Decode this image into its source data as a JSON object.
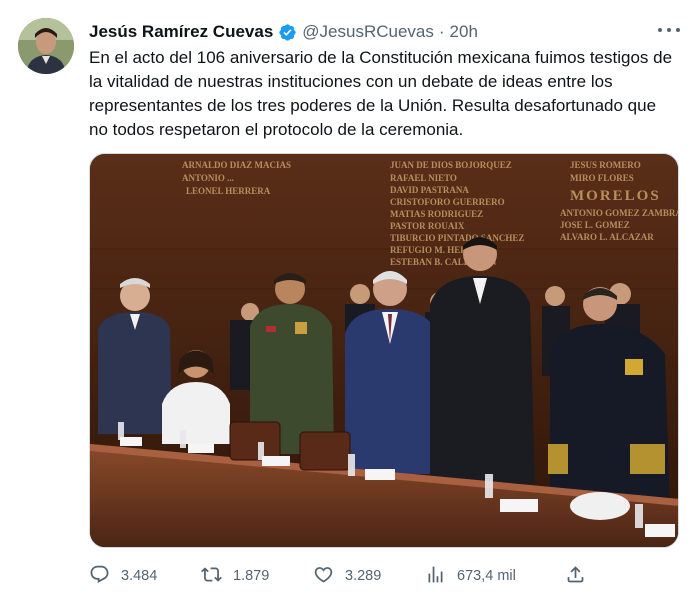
{
  "tweet": {
    "author": {
      "display_name": "Jesús Ramírez Cuevas",
      "handle": "@JesusRCuevas",
      "verified_icon": "verified-badge-icon",
      "avatar_alt": "avatar"
    },
    "separator": "·",
    "time": "20h",
    "more_icon": "more-options-icon",
    "text": "En el acto del 106 aniversario de la Constitución mexicana fuimos testigos de la vitalidad de nuestras instituciones con un debate de ideas entre los representantes de los tres poderes de la Unión. Resulta desafortunado que no todos respetaron el protocolo de la ceremonia.",
    "media": {
      "wall_engravings": [
        "ARNALDO DIAZ MACIAS",
        "ANTONIO ...",
        "LEONEL HERRERA",
        "JUAN DE DIOS BOJORQUEZ",
        "RAFAEL NIETO",
        "DAVID PASTRANA",
        "CRISTOFORO GUERRERO",
        "MATIAS RODRIGUEZ",
        "PASTOR ROUAIX",
        "TIBURCIO PINTADO SANCHEZ",
        "REFUGIO M. HEREDIA",
        "ESTEBAN B. CALDERON",
        "JESUS ROMERO",
        "MIRO FLORES",
        "MORELOS",
        "ANTONIO GOMEZ ZAMBRANO",
        "JOSE L. GOMEZ",
        "ALVARO L. ALCAZAR"
      ]
    },
    "actions": {
      "reply": {
        "icon": "reply-icon",
        "count": "3.484"
      },
      "retweet": {
        "icon": "retweet-icon",
        "count": "1.879"
      },
      "like": {
        "icon": "like-icon",
        "count": "3.289"
      },
      "views": {
        "icon": "views-icon",
        "count": "673,4 mil"
      },
      "share": {
        "icon": "share-icon"
      }
    }
  },
  "colors": {
    "text_primary": "#0f1419",
    "text_secondary": "#536471",
    "verified_blue": "#1d9bf0",
    "wall": "#4a2615"
  }
}
